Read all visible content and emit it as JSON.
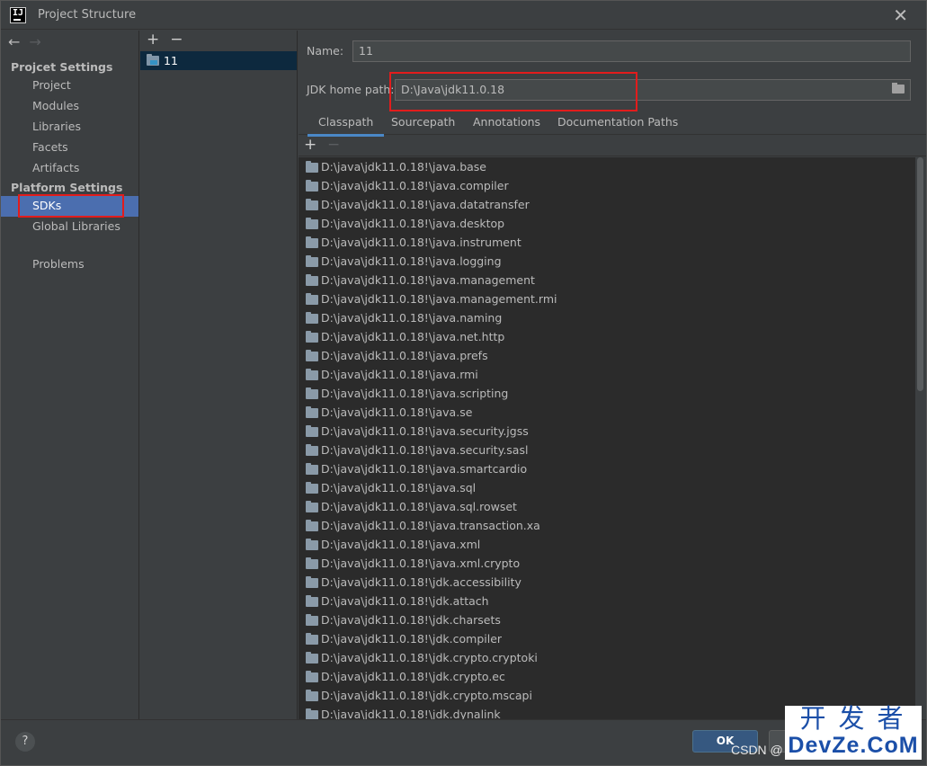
{
  "window": {
    "title": "Project Structure",
    "app_icon_text": "IJ",
    "close_glyph": "✕"
  },
  "left_nav": {
    "back_glyph": "←",
    "forward_glyph": "→",
    "project_settings_header": "Projcet Settings",
    "project_settings_items": [
      "Project",
      "Modules",
      "Libraries",
      "Facets",
      "Artifacts"
    ],
    "platform_settings_header": "Platform Settings",
    "platform_settings_items": [
      "SDKs",
      "Global Libraries"
    ],
    "selected_item": "SDKs",
    "problems_label": "Problems"
  },
  "sdk_list": {
    "add_glyph": "+",
    "remove_glyph": "−",
    "items": [
      "11"
    ],
    "selected": "11"
  },
  "details": {
    "name_label": "Name:",
    "name_value": "11",
    "jdk_home_label": "JDK home path:",
    "jdk_home_value": "D:\\Java\\jdk11.0.18",
    "tabs": [
      "Classpath",
      "Sourcepath",
      "Annotations",
      "Documentation Paths"
    ],
    "active_tab": "Classpath",
    "classpath_add_glyph": "+",
    "classpath_remove_glyph": "−",
    "classpath_entries": [
      "D:\\java\\jdk11.0.18!\\java.base",
      "D:\\java\\jdk11.0.18!\\java.compiler",
      "D:\\java\\jdk11.0.18!\\java.datatransfer",
      "D:\\java\\jdk11.0.18!\\java.desktop",
      "D:\\java\\jdk11.0.18!\\java.instrument",
      "D:\\java\\jdk11.0.18!\\java.logging",
      "D:\\java\\jdk11.0.18!\\java.management",
      "D:\\java\\jdk11.0.18!\\java.management.rmi",
      "D:\\java\\jdk11.0.18!\\java.naming",
      "D:\\java\\jdk11.0.18!\\java.net.http",
      "D:\\java\\jdk11.0.18!\\java.prefs",
      "D:\\java\\jdk11.0.18!\\java.rmi",
      "D:\\java\\jdk11.0.18!\\java.scripting",
      "D:\\java\\jdk11.0.18!\\java.se",
      "D:\\java\\jdk11.0.18!\\java.security.jgss",
      "D:\\java\\jdk11.0.18!\\java.security.sasl",
      "D:\\java\\jdk11.0.18!\\java.smartcardio",
      "D:\\java\\jdk11.0.18!\\java.sql",
      "D:\\java\\jdk11.0.18!\\java.sql.rowset",
      "D:\\java\\jdk11.0.18!\\java.transaction.xa",
      "D:\\java\\jdk11.0.18!\\java.xml",
      "D:\\java\\jdk11.0.18!\\java.xml.crypto",
      "D:\\java\\jdk11.0.18!\\jdk.accessibility",
      "D:\\java\\jdk11.0.18!\\jdk.attach",
      "D:\\java\\jdk11.0.18!\\jdk.charsets",
      "D:\\java\\jdk11.0.18!\\jdk.compiler",
      "D:\\java\\jdk11.0.18!\\jdk.crypto.cryptoki",
      "D:\\java\\jdk11.0.18!\\jdk.crypto.ec",
      "D:\\java\\jdk11.0.18!\\jdk.crypto.mscapi",
      "D:\\java\\jdk11.0.18!\\jdk.dynalink"
    ]
  },
  "footer": {
    "help_glyph": "?",
    "ok_label": "OK",
    "csdn_text": "CSDN @",
    "watermark_top": "开发者",
    "watermark_bottom": "DevZe.CoM"
  },
  "colors": {
    "window_bg": "#3c3f41",
    "list_bg": "#2b2b2b",
    "selection_blue": "#4b6eaf",
    "highlight_red": "#e21c1c",
    "ok_button": "#365880"
  }
}
